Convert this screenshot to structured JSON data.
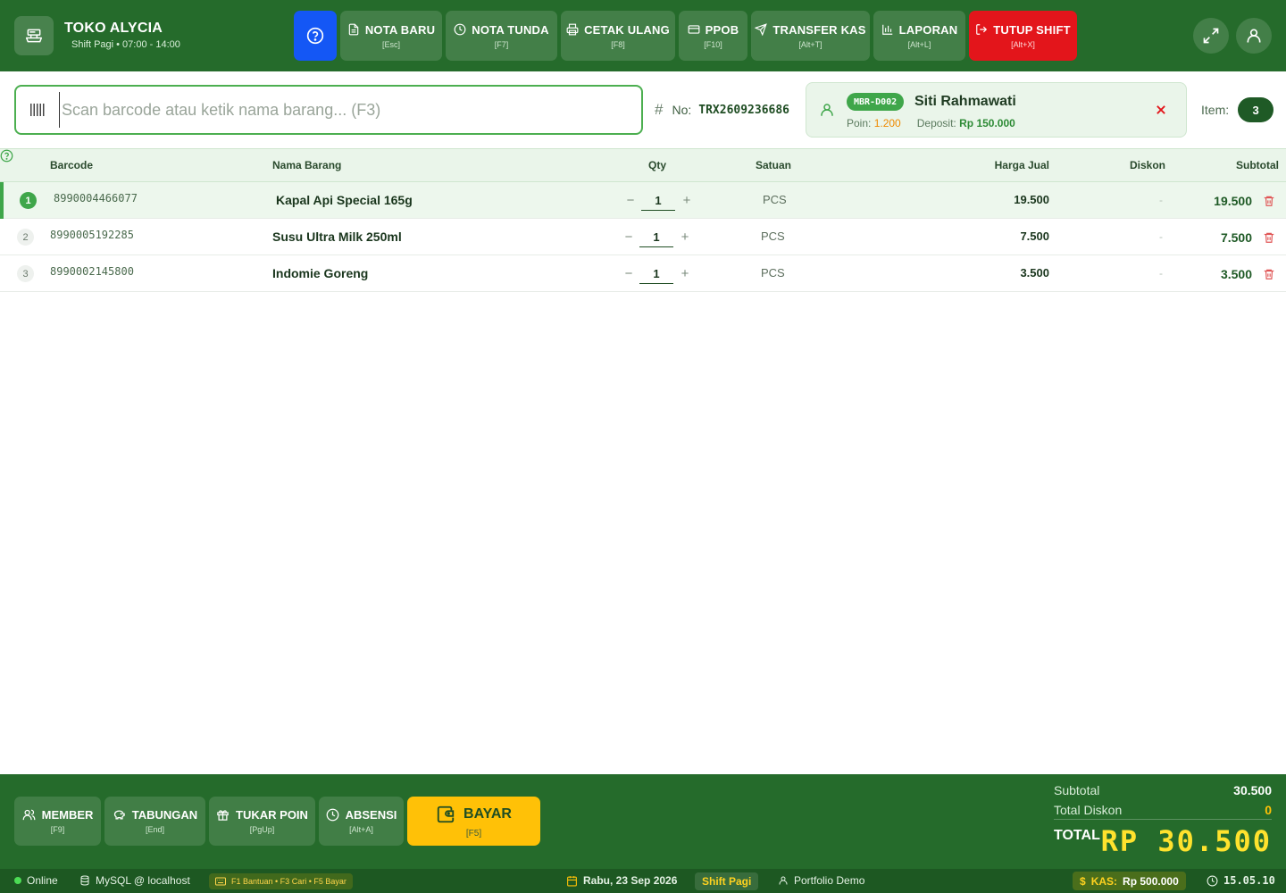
{
  "header": {
    "store_name": "TOKO ALYCIA",
    "shift_info": "Shift Pagi • 07:00 - 14:00",
    "nav": [
      {
        "label": "NOTA BARU",
        "key": "[Esc]"
      },
      {
        "label": "NOTA TUNDA",
        "key": "[F7]"
      },
      {
        "label": "CETAK ULANG",
        "key": "[F8]"
      },
      {
        "label": "PPOB",
        "key": "[F10]"
      },
      {
        "label": "TRANSFER KAS",
        "key": "[Alt+T]"
      },
      {
        "label": "LAPORAN",
        "key": "[Alt+L]"
      },
      {
        "label": "TUTUP SHIFT",
        "key": "[Alt+X]"
      }
    ]
  },
  "search": {
    "placeholder": "Scan barcode atau ketik nama barang... (F3)"
  },
  "transaction": {
    "no_label": "No:",
    "no_value": "TRX2609236686"
  },
  "member": {
    "code": "MBR-D002",
    "name": "Siti Rahmawati",
    "poin_label": "Poin:",
    "poin_value": "1.200",
    "deposit_label": "Deposit:",
    "deposit_value": "Rp 150.000"
  },
  "item_count": {
    "label": "Item:",
    "value": "3"
  },
  "table": {
    "columns": [
      "Barcode",
      "Nama Barang",
      "Qty",
      "Satuan",
      "Harga Jual",
      "Diskon",
      "Subtotal"
    ],
    "rows": [
      {
        "no": "1",
        "barcode": "8990004466077",
        "name": "Kapal Api Special 165g",
        "qty": "1",
        "unit": "PCS",
        "price": "19.500",
        "discount": "-",
        "subtotal": "19.500"
      },
      {
        "no": "2",
        "barcode": "8990005192285",
        "name": "Susu Ultra Milk 250ml",
        "qty": "1",
        "unit": "PCS",
        "price": "7.500",
        "discount": "-",
        "subtotal": "7.500"
      },
      {
        "no": "3",
        "barcode": "8990002145800",
        "name": "Indomie Goreng",
        "qty": "1",
        "unit": "PCS",
        "price": "3.500",
        "discount": "-",
        "subtotal": "3.500"
      }
    ]
  },
  "footer": {
    "buttons": [
      {
        "label": "MEMBER",
        "key": "[F9]"
      },
      {
        "label": "TABUNGAN",
        "key": "[End]"
      },
      {
        "label": "TUKAR POIN",
        "key": "[PgUp]"
      },
      {
        "label": "ABSENSI",
        "key": "[Alt+A]"
      }
    ],
    "pay": {
      "label": "BAYAR",
      "key": "[F5]"
    },
    "summary": {
      "subtotal_label": "Subtotal",
      "subtotal_value": "30.500",
      "discount_label": "Total Diskon",
      "discount_value": "0",
      "total_label": "TOTAL",
      "total_value": "RP 30.500"
    }
  },
  "status": {
    "online": "Online",
    "db": "MySQL @ localhost",
    "shortcuts": "F1 Bantuan • F3 Cari • F5 Bayar",
    "date": "Rabu, 23 Sep 2026",
    "shift": "Shift Pagi",
    "user": "Portfolio Demo",
    "kas_label": "KAS:",
    "kas_value": "Rp 500.000",
    "time": "15.05.10"
  },
  "colors": {
    "primary_green": "#256b2b",
    "help_blue": "#1457f5",
    "danger_red": "#e3151b",
    "pay_yellow": "#ffc107",
    "total_yellow": "#ffe22d"
  }
}
